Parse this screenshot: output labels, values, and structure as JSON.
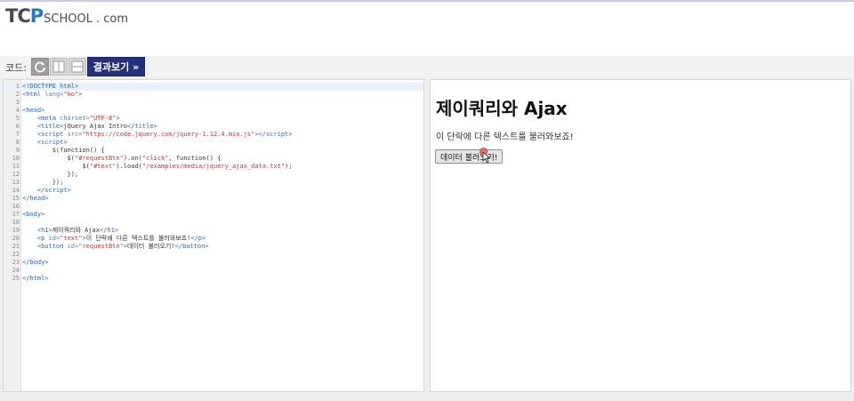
{
  "logo": {
    "part1": "TC",
    "part2": "P",
    "part3": "SCHOOL",
    "part4": ". com"
  },
  "toolbar": {
    "code_label": "코드:",
    "result_button": "결과보기 »"
  },
  "editor": {
    "lines": [
      {
        "n": "1",
        "html": "<span class=\"t\">&lt;!DOCTYPE html&gt;</span>"
      },
      {
        "n": "2",
        "html": "<span class=\"t\">&lt;html</span> <span class=\"a\">lang=</span><span class=\"s\">\"ko\"</span><span class=\"t\">&gt;</span>"
      },
      {
        "n": "3",
        "html": ""
      },
      {
        "n": "4",
        "html": "<span class=\"t\">&lt;head&gt;</span>"
      },
      {
        "n": "5",
        "html": "    <span class=\"t\">&lt;meta</span> <span class=\"a\">charset=</span><span class=\"s\">\"UTF-8\"</span><span class=\"t\">&gt;</span>"
      },
      {
        "n": "6",
        "html": "    <span class=\"t\">&lt;title&gt;</span><span class=\"p\">jQuery Ajax Intro</span><span class=\"t\">&lt;/title&gt;</span>"
      },
      {
        "n": "7",
        "html": "    <span class=\"t\">&lt;script</span> <span class=\"a\">src=</span><span class=\"s\">\"https://code.jquery.com/jquery-1.12.4.min.js\"</span><span class=\"t\">&gt;&lt;/script&gt;</span>"
      },
      {
        "n": "8",
        "html": "    <span class=\"t\">&lt;script&gt;</span>"
      },
      {
        "n": "9",
        "html": "        <span class=\"p\">$(function() {</span>"
      },
      {
        "n": "10",
        "html": "            <span class=\"p\">$(</span><span class=\"s\">\"#requestBtn\"</span><span class=\"p\">).on(</span><span class=\"s\">\"click\"</span><span class=\"p\">, function() {</span>"
      },
      {
        "n": "11",
        "html": "                <span class=\"p\">$(</span><span class=\"s\">\"#text\"</span><span class=\"p\">).load(</span><span class=\"s\">\"/examples/media/jquery_ajax_data.txt\"</span><span class=\"p\">);</span>"
      },
      {
        "n": "12",
        "html": "            <span class=\"p\">});</span>"
      },
      {
        "n": "13",
        "html": "        <span class=\"p\">});</span>"
      },
      {
        "n": "14",
        "html": "    <span class=\"t\">&lt;/script&gt;</span>"
      },
      {
        "n": "15",
        "html": "<span class=\"t\">&lt;/head&gt;</span>"
      },
      {
        "n": "16",
        "html": ""
      },
      {
        "n": "17",
        "html": "<span class=\"t\">&lt;body&gt;</span>"
      },
      {
        "n": "18",
        "html": ""
      },
      {
        "n": "19",
        "html": "    <span class=\"t\">&lt;h1&gt;</span><span class=\"p\">제이쿼리와 Ajax</span><span class=\"t\">&lt;/h1&gt;</span>"
      },
      {
        "n": "20",
        "html": "    <span class=\"t\">&lt;p</span> <span class=\"a\">id=</span><span class=\"s\">\"text\"</span><span class=\"t\">&gt;</span><span class=\"p\">이 단락에 다른 텍스트를 불러와보죠!</span><span class=\"t\">&lt;/p&gt;</span>"
      },
      {
        "n": "21",
        "html": "    <span class=\"t\">&lt;button</span> <span class=\"a\">id=</span><span class=\"s\">\"requestBtn\"</span><span class=\"t\">&gt;</span><span class=\"p\">데이터 불러오기!</span><span class=\"t\">&lt;/button&gt;</span>"
      },
      {
        "n": "22",
        "html": ""
      },
      {
        "n": "23",
        "html": "<span class=\"t\">&lt;/body&gt;</span>"
      },
      {
        "n": "24",
        "html": ""
      },
      {
        "n": "25",
        "html": "<span class=\"t\">&lt;/html&gt;</span>"
      }
    ]
  },
  "preview": {
    "title": "제이쿼리와 Ajax",
    "paragraph": "이 단락에 다른 텍스트를 불러와보죠!",
    "button": "데이터 불러오기!"
  }
}
